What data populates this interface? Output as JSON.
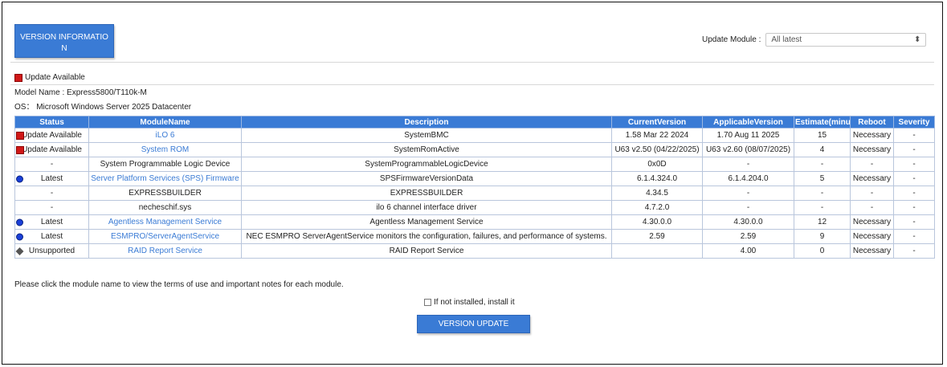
{
  "header": {
    "version_info_button": "VERSION INFORMATIO N",
    "update_module_label": "Update Module :",
    "update_module_value": "All latest"
  },
  "legend": {
    "update_available": "Update Available"
  },
  "info": {
    "model_name": "Model Name : Express5800/T110k-M",
    "os": "OS： Microsoft Windows Server 2025 Datacenter"
  },
  "table": {
    "columns": [
      "Status",
      "ModuleName",
      "Description",
      "CurrentVersion",
      "ApplicableVersion",
      "Estimate(minute)",
      "Reboot",
      "Severity"
    ],
    "rows": [
      {
        "icon": "red-square",
        "status": "Update Available",
        "module": "iLO 6",
        "link": true,
        "description": "SystemBMC",
        "current": "1.58 Mar 22 2024",
        "applicable": "1.70 Aug 11 2025",
        "estimate": "15",
        "reboot": "Necessary",
        "severity": "-"
      },
      {
        "icon": "red-square",
        "status": "Update Available",
        "module": "System ROM",
        "link": true,
        "description": "SystemRomActive",
        "current": "U63 v2.50 (04/22/2025)",
        "applicable": "U63 v2.60 (08/07/2025)",
        "estimate": "4",
        "reboot": "Necessary",
        "severity": "-"
      },
      {
        "icon": "",
        "status": "-",
        "module": "System Programmable Logic Device",
        "link": false,
        "description": "SystemProgrammableLogicDevice",
        "current": "0x0D",
        "applicable": "-",
        "estimate": "-",
        "reboot": "-",
        "severity": "-"
      },
      {
        "icon": "blue-dot",
        "status": "Latest",
        "module": "Server Platform Services (SPS) Firmware",
        "link": true,
        "description": "SPSFirmwareVersionData",
        "current": "6.1.4.324.0",
        "applicable": "6.1.4.204.0",
        "estimate": "5",
        "reboot": "Necessary",
        "severity": "-"
      },
      {
        "icon": "",
        "status": "-",
        "module": "EXPRESSBUILDER",
        "link": false,
        "description": "EXPRESSBUILDER",
        "current": "4.34.5",
        "applicable": "-",
        "estimate": "-",
        "reboot": "-",
        "severity": "-"
      },
      {
        "icon": "",
        "status": "-",
        "module": "necheschif.sys",
        "link": false,
        "description": "ilo 6 channel interface driver",
        "current": "4.7.2.0",
        "applicable": "-",
        "estimate": "-",
        "reboot": "-",
        "severity": "-"
      },
      {
        "icon": "blue-dot",
        "status": "Latest",
        "module": "Agentless Management Service",
        "link": true,
        "description": "Agentless Management Service",
        "current": "4.30.0.0",
        "applicable": "4.30.0.0",
        "estimate": "12",
        "reboot": "Necessary",
        "severity": "-"
      },
      {
        "icon": "blue-dot",
        "status": "Latest",
        "module": "ESMPRO/ServerAgentService",
        "link": true,
        "description": "NEC ESMPRO ServerAgentService monitors the configuration, failures, and performance of systems.",
        "current": "2.59",
        "applicable": "2.59",
        "estimate": "9",
        "reboot": "Necessary",
        "severity": "-"
      },
      {
        "icon": "grey-diamond",
        "status": "Unsupported",
        "module": "RAID Report Service",
        "link": true,
        "description": "RAID Report Service",
        "current": "",
        "applicable": "4.00",
        "estimate": "0",
        "reboot": "Necessary",
        "severity": "-"
      }
    ]
  },
  "footer": {
    "note": "Please click the module name to view the terms of use and important notes for each module.",
    "install_checkbox_label": "If not installed, install it",
    "version_update_button": "VERSION UPDATE"
  },
  "colors": {
    "accent": "#3a7bd5",
    "update_red": "#d01818",
    "latest_blue": "#1a3fd8"
  }
}
